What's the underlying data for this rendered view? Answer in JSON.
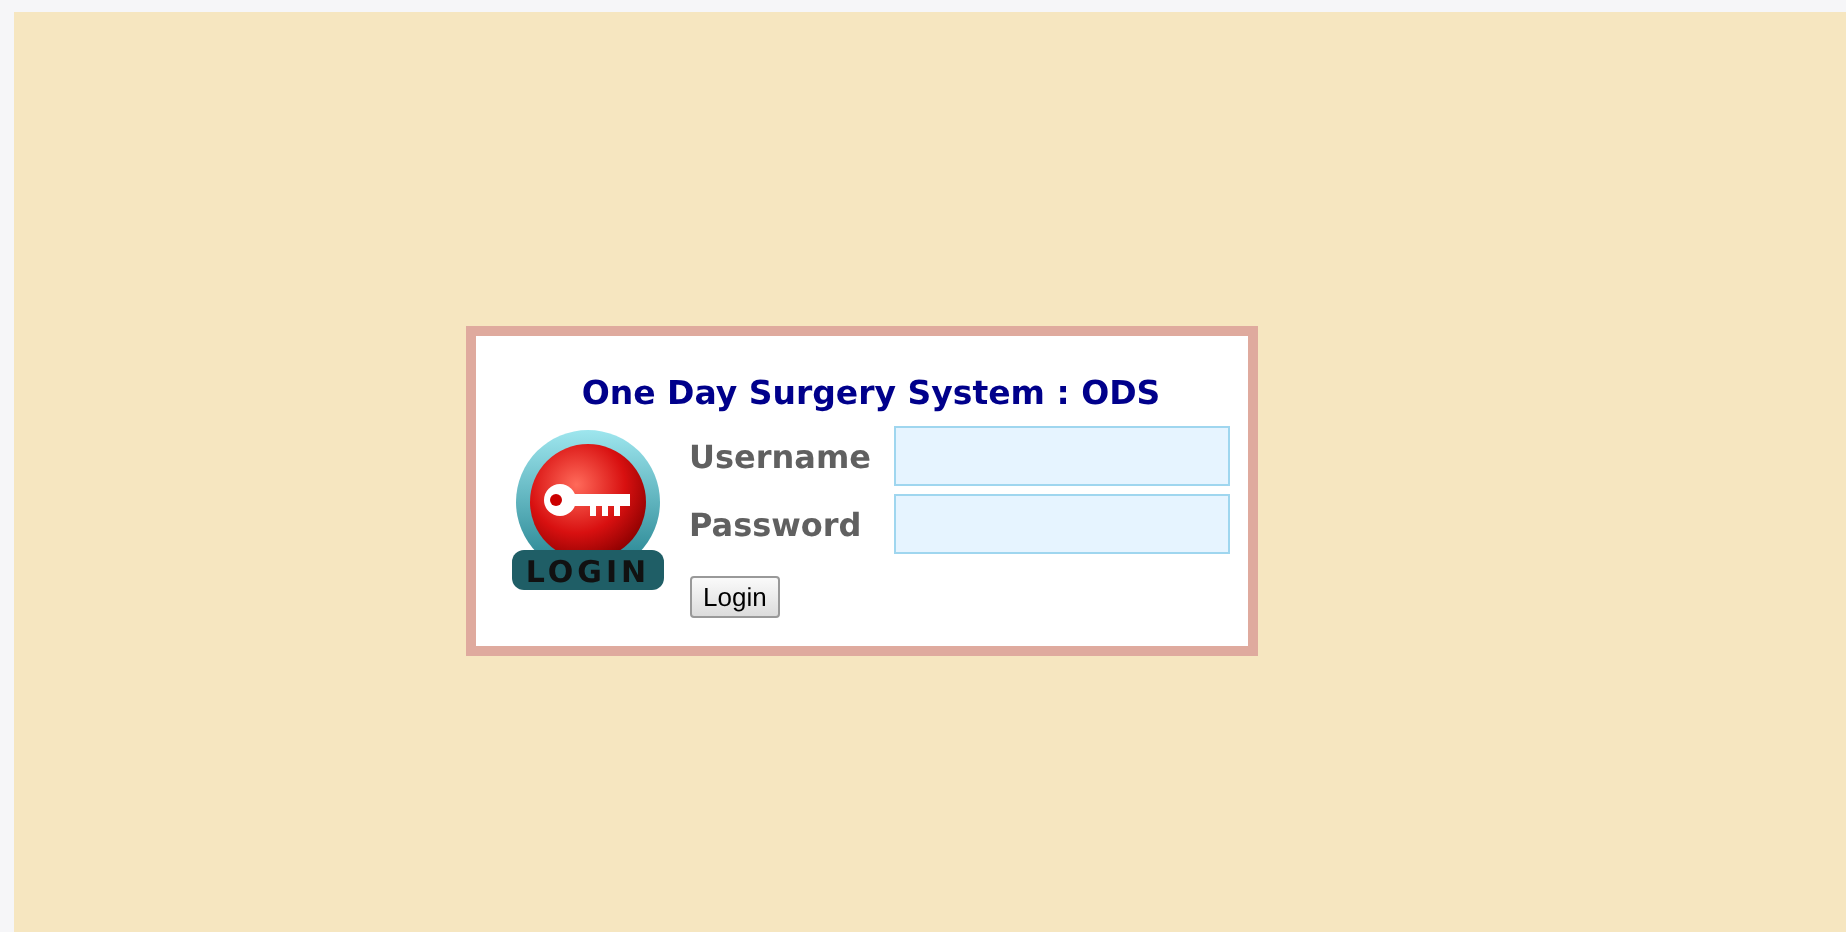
{
  "title": "One Day Surgery System : ODS",
  "emblem": {
    "label": "LOGIN"
  },
  "fields": [
    {
      "label": "Username"
    },
    {
      "label": "Password"
    }
  ],
  "button": "Login"
}
